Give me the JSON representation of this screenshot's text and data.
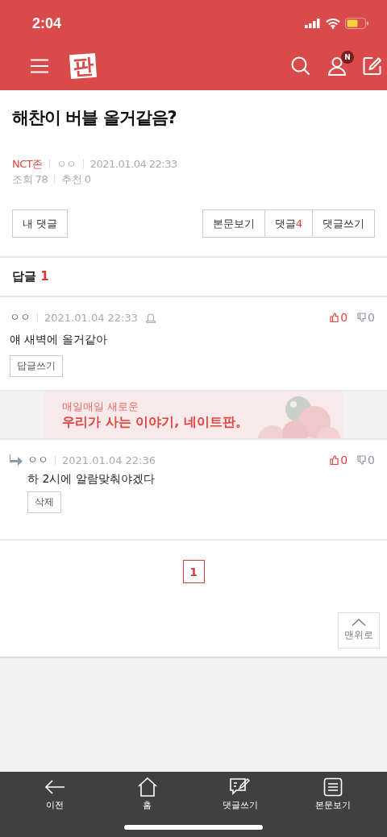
{
  "status_bar": {
    "time": "2:04"
  },
  "header": {
    "logo": "판",
    "badge": "N"
  },
  "post": {
    "title": "해찬이 버블 올거같음?",
    "board": "NCT존",
    "author": "ㅇㅇ",
    "date": "2021.01.04 22:33",
    "views_label": "조회",
    "views": "78",
    "recommend_label": "추천",
    "recommend": "0"
  },
  "actions": {
    "left": "내 댓글",
    "right": [
      {
        "label": "본문보기"
      },
      {
        "label": "댓글",
        "count": "4"
      },
      {
        "label": "댓글쓰기"
      }
    ]
  },
  "replies_header": {
    "label": "답글",
    "count": "1"
  },
  "comments": [
    {
      "kind": "comment",
      "author": "ㅇㅇ",
      "date": "2021.01.04 22:33",
      "text": "얘 새벽에 올거같아",
      "likes": "0",
      "dislikes": "0",
      "button": "답글쓰기",
      "report_icon": true
    },
    {
      "kind": "ad",
      "line1": "매일매일 새로운",
      "line2": "우리가 사는 이야기, 네이트판。"
    },
    {
      "kind": "reply",
      "author": "ㅇㅇ",
      "date": "2021.01.04 22:36",
      "text": "하 2시에 알람맞춰야겠다",
      "likes": "0",
      "dislikes": "0",
      "button": "삭제",
      "report_icon": false
    }
  ],
  "pagination": [
    {
      "label": "1",
      "selected": true
    }
  ],
  "top_button": "맨위로",
  "bottom_bar": [
    {
      "kind": "back",
      "label": "이전"
    },
    {
      "kind": "home",
      "label": "홈"
    },
    {
      "kind": "write",
      "label": "댓글쓰기"
    },
    {
      "kind": "doc",
      "label": "본문보기"
    }
  ]
}
